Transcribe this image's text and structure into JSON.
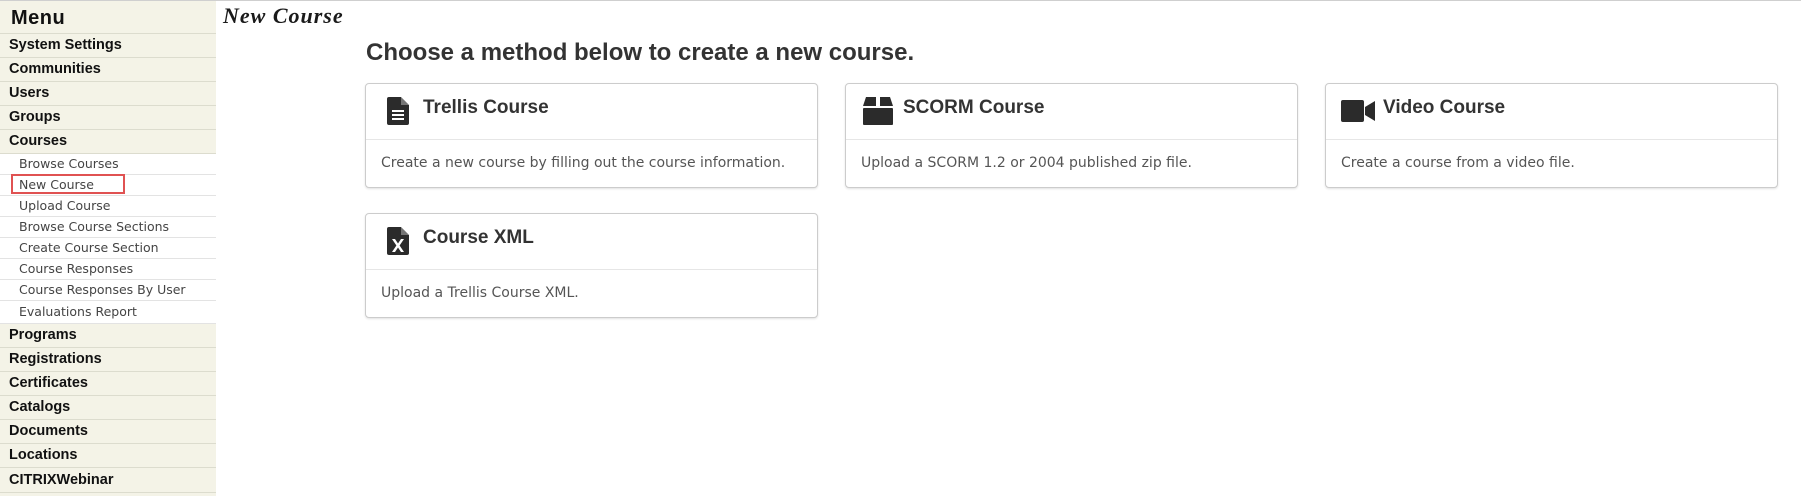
{
  "sidebar": {
    "title": "Menu",
    "items_top": [
      "System Settings",
      "Communities",
      "Users",
      "Groups",
      "Courses"
    ],
    "courses_submenu": [
      "Browse Courses",
      "New Course",
      "Upload Course",
      "Browse Course Sections",
      "Create Course Section",
      "Course Responses",
      "Course Responses By User",
      "Evaluations Report"
    ],
    "items_bottom": [
      "Programs",
      "Registrations",
      "Certificates",
      "Catalogs",
      "Documents",
      "Locations",
      "CITRIXWebinar"
    ]
  },
  "page": {
    "heading": "New Course",
    "instruction": "Choose a method below to create a new course."
  },
  "cards": [
    {
      "title": "Trellis Course",
      "description": "Create a new course by filling out the course information.",
      "icon": "document-icon"
    },
    {
      "title": "SCORM Course",
      "description": "Upload a SCORM 1.2 or 2004 published zip file.",
      "icon": "package-icon"
    },
    {
      "title": "Video Course",
      "description": "Create a course from a video file.",
      "icon": "video-camera-icon"
    },
    {
      "title": "Course XML",
      "description": "Upload a Trellis Course XML.",
      "icon": "excel-file-icon"
    }
  ],
  "colors": {
    "sidebar_bg": "#f4f3e7",
    "highlight_border": "#e05252",
    "icon": "#2b2b2b"
  }
}
